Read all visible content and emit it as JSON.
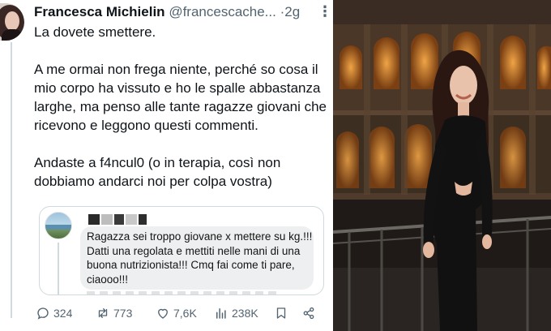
{
  "tweet": {
    "display_name": "Francesca Michielin",
    "handle": "@francescache...",
    "separator": "·",
    "time": "2g",
    "more_icon": "more-horizontal-icon",
    "paragraphs": [
      "La dovete smettere.",
      "A me ormai non frega niente, perché so cosa il mio corpo ha vissuto e ho le spalle abbastanza larghe, ma penso alle tante ragazze giovani che ricevono e leggono questi commenti.",
      "Andaste a f4ncul0 (o in terapia, così non dobbiamo andarci noi per colpa vostra)"
    ]
  },
  "quote": {
    "comment": "Ragazza sei troppo giovane x mettere su kg.!!! Datti una regolata e mettiti nelle mani di una buona nutrizionista!!! Cmq fai come ti pare, ciaooo!!!"
  },
  "actions": {
    "reply": {
      "icon": "reply-icon",
      "count": "324"
    },
    "repost": {
      "icon": "repost-icon",
      "count": "773"
    },
    "like": {
      "icon": "heart-icon",
      "count": "7,6K"
    },
    "views": {
      "icon": "views-icon",
      "count": "238K"
    },
    "bookmark": {
      "icon": "bookmark-icon"
    },
    "share": {
      "icon": "share-icon"
    }
  },
  "colors": {
    "text": "#0f1419",
    "secondary": "#536471",
    "border": "#cfd9de"
  }
}
